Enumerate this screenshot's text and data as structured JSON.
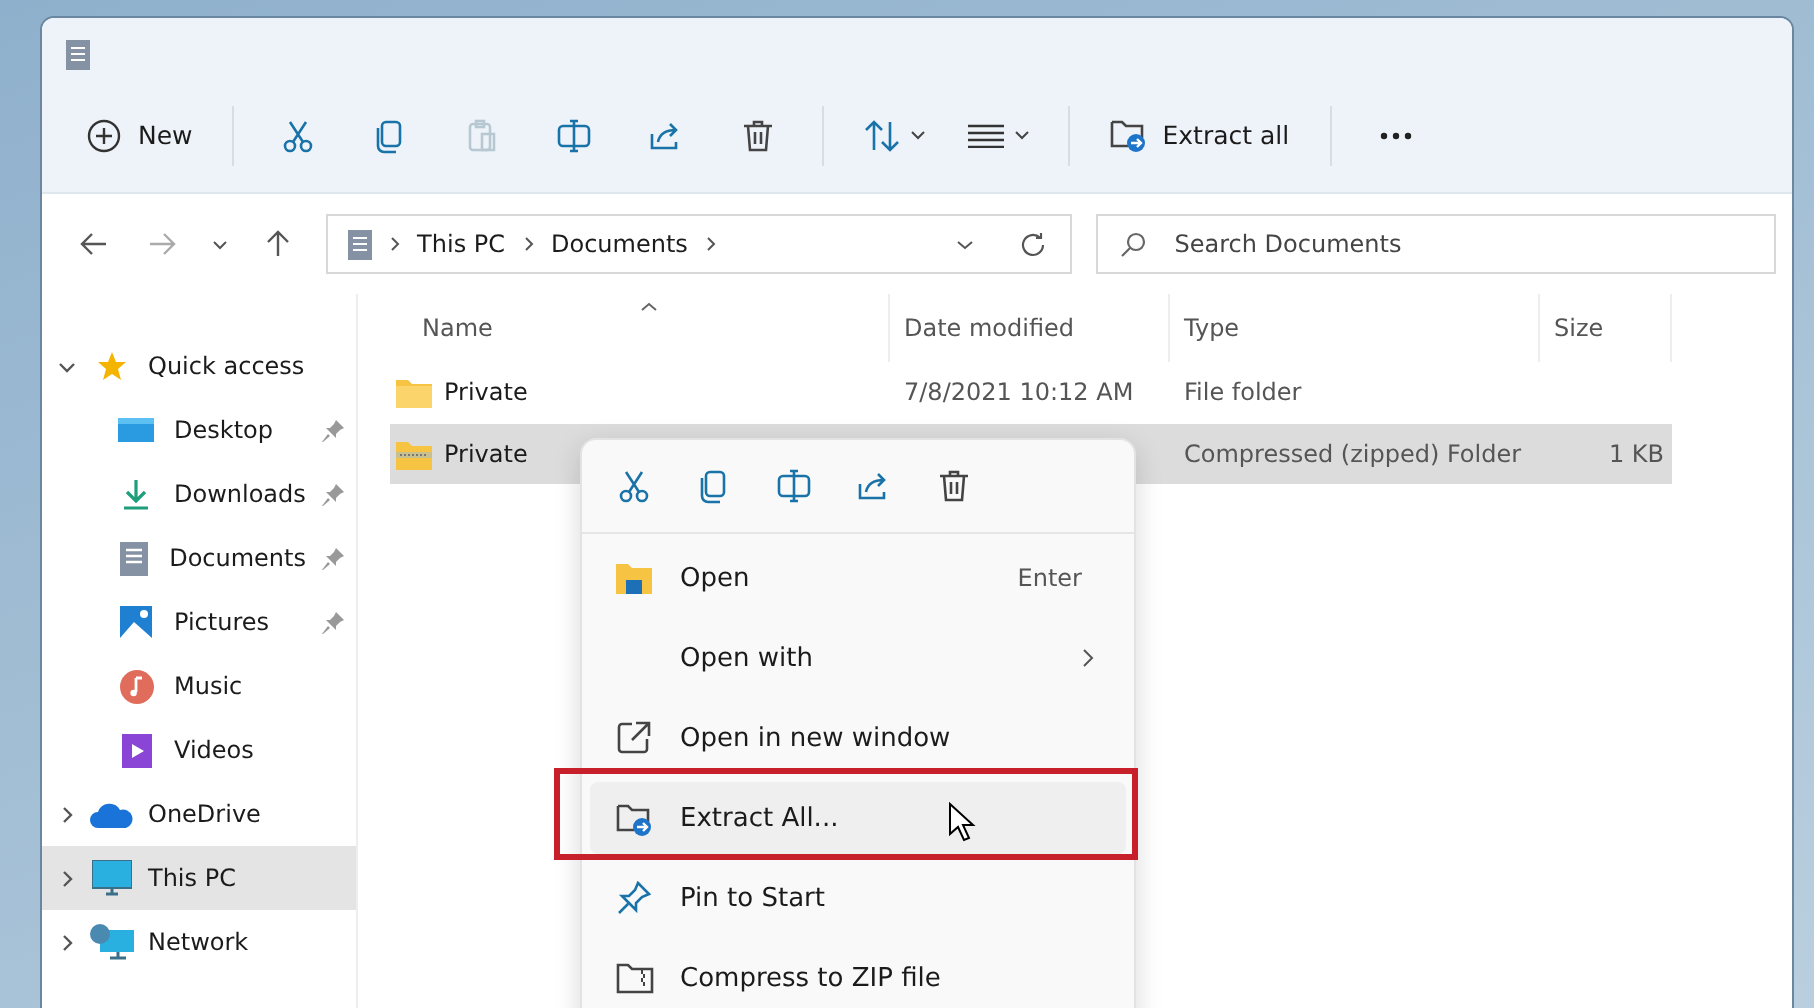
{
  "toolbar": {
    "new_label": "New",
    "actions": [
      {
        "kind": "cut",
        "disabled": false
      },
      {
        "kind": "copy",
        "disabled": false
      },
      {
        "kind": "paste",
        "disabled": true
      },
      {
        "kind": "rename",
        "disabled": false
      },
      {
        "kind": "share",
        "disabled": false
      },
      {
        "kind": "delete",
        "disabled": false
      }
    ],
    "extract_label": "Extract all"
  },
  "address": {
    "path": [
      "This PC",
      "Documents"
    ]
  },
  "search": {
    "placeholder": "Search Documents"
  },
  "sidebar": {
    "items": [
      {
        "label": "Quick access",
        "kind": "star",
        "expanded": true,
        "selected": false,
        "children": [
          {
            "label": "Desktop",
            "kind": "desktop",
            "pinned": true
          },
          {
            "label": "Downloads",
            "kind": "download",
            "pinned": true
          },
          {
            "label": "Documents",
            "kind": "document",
            "pinned": true
          },
          {
            "label": "Pictures",
            "kind": "picture",
            "pinned": true
          },
          {
            "label": "Music",
            "kind": "music",
            "pinned": false
          },
          {
            "label": "Videos",
            "kind": "video",
            "pinned": false
          }
        ]
      },
      {
        "label": "OneDrive",
        "kind": "cloud",
        "expanded": false,
        "selected": false
      },
      {
        "label": "This PC",
        "kind": "pc",
        "expanded": false,
        "selected": true
      },
      {
        "label": "Network",
        "kind": "network",
        "expanded": false,
        "selected": false
      }
    ]
  },
  "table": {
    "columns": [
      "Name",
      "Date modified",
      "Type",
      "Size"
    ],
    "rows": [
      {
        "name": "Private",
        "kind": "folder",
        "date": "7/8/2021 10:12 AM",
        "type": "File folder",
        "selected": false
      },
      {
        "name": "Private",
        "kind": "zip",
        "type": "Compressed (zipped) Folder",
        "size": "1 KB",
        "selected": true
      }
    ]
  },
  "context_menu": {
    "actions": [
      {
        "kind": "cut"
      },
      {
        "kind": "copy"
      },
      {
        "kind": "rename"
      },
      {
        "kind": "share"
      },
      {
        "kind": "delete"
      }
    ],
    "items": [
      {
        "label": "Open",
        "kind": "open",
        "shortcut": "Enter",
        "highlighted": false
      },
      {
        "label": "Open with",
        "kind": "submenu",
        "highlighted": false
      },
      {
        "label": "Open in new window",
        "kind": "newwindow",
        "highlighted": false
      },
      {
        "label": "Extract All...",
        "kind": "extract",
        "highlighted": true
      },
      {
        "label": "Pin to Start",
        "kind": "pin",
        "highlighted": false
      },
      {
        "label": "Compress to ZIP file",
        "kind": "zip",
        "highlighted": false
      }
    ]
  }
}
